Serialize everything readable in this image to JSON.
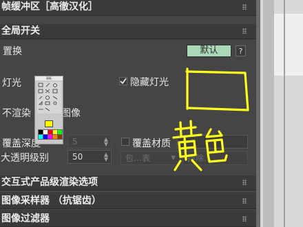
{
  "panel": {
    "section_frame_buffer": "帧缓冲区［高徹汉化］",
    "section_global_switches": "全局开关",
    "replace_label": "置换",
    "default_button": "默认",
    "help_button": "?",
    "lights_label": "灯光",
    "hidden_lights_label": "隐藏灯光",
    "dont_render_label": "不渲染",
    "image_label": "图像",
    "override_depth_label": "覆盖深度",
    "override_depth_value": "5",
    "override_material_label": "覆盖材质",
    "max_transparency_label": "大透明级别",
    "max_transparency_value": "50",
    "include_label": "包…表",
    "exclude_label": "排除…",
    "section_interactive": "交互式产品级渲染选项",
    "section_image_sampler": "图像采样器 （抗锯齿）",
    "section_image_filter": "图像过滤器"
  },
  "palette": {
    "title": "画板",
    "colors": [
      "#000000",
      "#ffffff",
      "#ff0000",
      "#ffff00",
      "#00ff00",
      "#00ffff",
      "#0000ff",
      "#ff00ff",
      "#ff8000",
      "#804000",
      "#808080",
      "#c0c0c0"
    ]
  },
  "annotation": {
    "text": "黄色",
    "ink_color": "#ffff1e"
  }
}
